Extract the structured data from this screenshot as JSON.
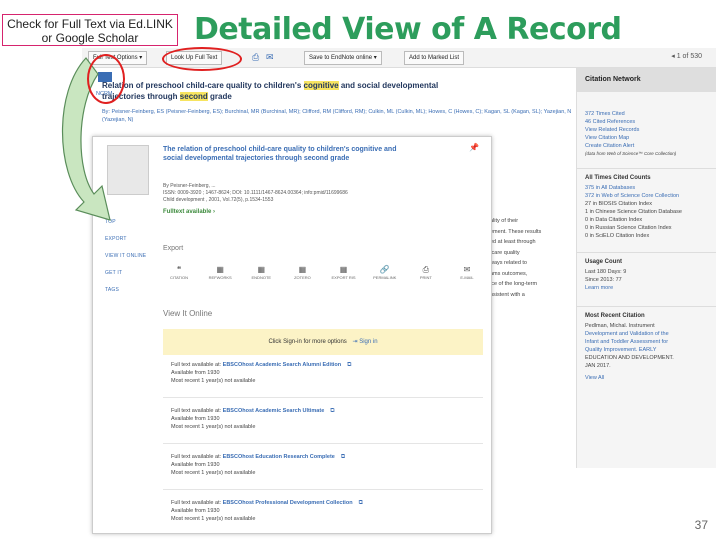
{
  "slide": {
    "callout": "Check for Full Text via Ed.LINK or Google Scholar",
    "title": "Detailed View of A Record",
    "number": "37"
  },
  "toolbar": {
    "full_text_options": "Full Text Options ▾",
    "look_up_full_text": "Look Up Full Text",
    "save_to_endnote": "Save to EndNote online ▾",
    "add_to_marked_list": "Add to Marked List",
    "pager": "◂ 1 of 530"
  },
  "record": {
    "left_links": [
      "NCRM"
    ],
    "title_before": "Relation of preschool child-care quality to children's ",
    "title_hl1": "cognitive",
    "title_mid": " and social developmental ",
    "title_line2_prefix": "trajectories through ",
    "title_hl2": "second",
    "title_after": " grade",
    "authors": "By: Peisner-Feinberg, ES (Peisner-Feinberg, ES); Burchinal, MR (Burchinal, MR); Clifford, RM (Clifford, RM); Culkin, ML (Culkin, ML); Howes, C (Howes, C); Kagan, SL (Kagan, SL); Yazejian, N (Yazejian, N)",
    "snippet_lines": [
      "ality of their",
      "ement. These results",
      "ed at least through",
      "tcare quality",
      "ways related to",
      "ams outcomes,",
      "ice of the long-term",
      "nsistent with a"
    ]
  },
  "citation_network": {
    "header": "Citation Network",
    "lines": [
      "372 Times Cited",
      "46 Cited References",
      "View Related Records",
      "View Citation Map",
      "Create Citation Alert",
      "(data from Web of Science™ Core Collection)"
    ],
    "all_times_cited_title": "All Times Cited Counts",
    "all_times_cited": [
      "375 in All Databases",
      "372 in Web of Science Core Collection",
      "27 in BIOSIS Citation Index",
      "1 in Chinese Science Citation Database",
      "0 in Data Citation Index",
      "0 in Russian Science Citation Index",
      "0 in SciELO Citation Index"
    ],
    "usage_title": "Usage Count",
    "usage": [
      "Last 180 Days: 9",
      "Since 2013: 77",
      "Learn more"
    ],
    "recent_title": "Most Recent Citation",
    "recent": [
      "Pedlman, Michal. Instrument",
      "Development and Validation of the",
      "Infant and Toddler Assessment for",
      "Quality Improvement. EARLY",
      "EDUCATION AND DEVELOPMENT.",
      "JAN 2017.",
      "View All"
    ]
  },
  "popup": {
    "title": "The relation of preschool child-care quality to children's cognitive and social developmental trajectories through second grade",
    "meta1": "By Peisner-Feinberg, ...",
    "meta2": "ISSN: 0009-3920 ; 1467-8624; DOI: 10.1111/1467-8624.00364; info:pmid/11699686",
    "meta3": "Child development , 2001, Vol.72(5), p.1534-1553",
    "fulltext": "Fulltext available  ›",
    "side_links": [
      "TOP",
      "EXPORT",
      "VIEW IT ONLINE",
      "GET IT",
      "TAGS"
    ],
    "export_label": "Export",
    "export_items": [
      {
        "icon": "❝",
        "label": "CITATION"
      },
      {
        "icon": "▦",
        "label": "REFWORKS"
      },
      {
        "icon": "▦",
        "label": "ENDNOTE"
      },
      {
        "icon": "▦",
        "label": "ZOTERO"
      },
      {
        "icon": "▦",
        "label": "EXPORT RIS"
      },
      {
        "icon": "🔗",
        "label": "PERMALINK"
      },
      {
        "icon": "⎙",
        "label": "PRINT"
      },
      {
        "icon": "✉",
        "label": "E-MAIL"
      }
    ],
    "view_online": "View It Online",
    "signin_text": "Click Sign-in for more options",
    "signin_link": "Sign in",
    "holdings": [
      {
        "label": "Full text available at:",
        "link": "EBSCOhost Academic Search Alumni Edition",
        "from": "Available from 1930",
        "recent": "Most recent 1 year(s) not available"
      },
      {
        "label": "Full text available at:",
        "link": "EBSCOhost Academic Search Ultimate",
        "from": "Available from 1930",
        "recent": "Most recent 1 year(s) not available"
      },
      {
        "label": "Full text available at:",
        "link": "EBSCOhost Education Research Complete",
        "from": "Available from 1930",
        "recent": "Most recent 1 year(s) not available"
      },
      {
        "label": "Full text available at:",
        "link": "EBSCOhost Professional Development Collection",
        "from": "Available from 1930",
        "recent": "Most recent 1 year(s) not available"
      }
    ]
  },
  "colors": {
    "title_green": "#2d9d5c",
    "link_blue": "#3a6db4",
    "highlight": "#f7e460",
    "annotation_red": "#e02020"
  }
}
